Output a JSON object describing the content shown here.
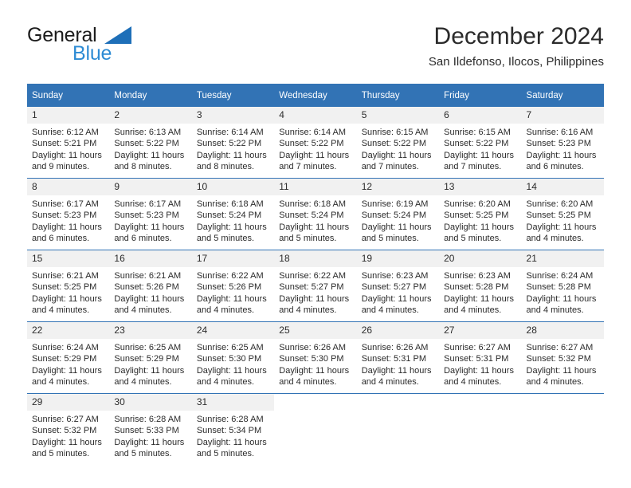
{
  "logo": {
    "word_one": "General",
    "word_two": "Blue",
    "triangle_color": "#1e6fb8",
    "blue_color": "#2d8bd4"
  },
  "header": {
    "title": "December 2024",
    "subtitle": "San Ildefonso, Ilocos, Philippines",
    "accent_color": "#3273b5"
  },
  "calendar": {
    "weekday_headers": [
      "Sunday",
      "Monday",
      "Tuesday",
      "Wednesday",
      "Thursday",
      "Friday",
      "Saturday"
    ],
    "weeks": [
      [
        {
          "day": "1",
          "sunrise": "Sunrise: 6:12 AM",
          "sunset": "Sunset: 5:21 PM",
          "daylight": "Daylight: 11 hours and 9 minutes."
        },
        {
          "day": "2",
          "sunrise": "Sunrise: 6:13 AM",
          "sunset": "Sunset: 5:22 PM",
          "daylight": "Daylight: 11 hours and 8 minutes."
        },
        {
          "day": "3",
          "sunrise": "Sunrise: 6:14 AM",
          "sunset": "Sunset: 5:22 PM",
          "daylight": "Daylight: 11 hours and 8 minutes."
        },
        {
          "day": "4",
          "sunrise": "Sunrise: 6:14 AM",
          "sunset": "Sunset: 5:22 PM",
          "daylight": "Daylight: 11 hours and 7 minutes."
        },
        {
          "day": "5",
          "sunrise": "Sunrise: 6:15 AM",
          "sunset": "Sunset: 5:22 PM",
          "daylight": "Daylight: 11 hours and 7 minutes."
        },
        {
          "day": "6",
          "sunrise": "Sunrise: 6:15 AM",
          "sunset": "Sunset: 5:22 PM",
          "daylight": "Daylight: 11 hours and 7 minutes."
        },
        {
          "day": "7",
          "sunrise": "Sunrise: 6:16 AM",
          "sunset": "Sunset: 5:23 PM",
          "daylight": "Daylight: 11 hours and 6 minutes."
        }
      ],
      [
        {
          "day": "8",
          "sunrise": "Sunrise: 6:17 AM",
          "sunset": "Sunset: 5:23 PM",
          "daylight": "Daylight: 11 hours and 6 minutes."
        },
        {
          "day": "9",
          "sunrise": "Sunrise: 6:17 AM",
          "sunset": "Sunset: 5:23 PM",
          "daylight": "Daylight: 11 hours and 6 minutes."
        },
        {
          "day": "10",
          "sunrise": "Sunrise: 6:18 AM",
          "sunset": "Sunset: 5:24 PM",
          "daylight": "Daylight: 11 hours and 5 minutes."
        },
        {
          "day": "11",
          "sunrise": "Sunrise: 6:18 AM",
          "sunset": "Sunset: 5:24 PM",
          "daylight": "Daylight: 11 hours and 5 minutes."
        },
        {
          "day": "12",
          "sunrise": "Sunrise: 6:19 AM",
          "sunset": "Sunset: 5:24 PM",
          "daylight": "Daylight: 11 hours and 5 minutes."
        },
        {
          "day": "13",
          "sunrise": "Sunrise: 6:20 AM",
          "sunset": "Sunset: 5:25 PM",
          "daylight": "Daylight: 11 hours and 5 minutes."
        },
        {
          "day": "14",
          "sunrise": "Sunrise: 6:20 AM",
          "sunset": "Sunset: 5:25 PM",
          "daylight": "Daylight: 11 hours and 4 minutes."
        }
      ],
      [
        {
          "day": "15",
          "sunrise": "Sunrise: 6:21 AM",
          "sunset": "Sunset: 5:25 PM",
          "daylight": "Daylight: 11 hours and 4 minutes."
        },
        {
          "day": "16",
          "sunrise": "Sunrise: 6:21 AM",
          "sunset": "Sunset: 5:26 PM",
          "daylight": "Daylight: 11 hours and 4 minutes."
        },
        {
          "day": "17",
          "sunrise": "Sunrise: 6:22 AM",
          "sunset": "Sunset: 5:26 PM",
          "daylight": "Daylight: 11 hours and 4 minutes."
        },
        {
          "day": "18",
          "sunrise": "Sunrise: 6:22 AM",
          "sunset": "Sunset: 5:27 PM",
          "daylight": "Daylight: 11 hours and 4 minutes."
        },
        {
          "day": "19",
          "sunrise": "Sunrise: 6:23 AM",
          "sunset": "Sunset: 5:27 PM",
          "daylight": "Daylight: 11 hours and 4 minutes."
        },
        {
          "day": "20",
          "sunrise": "Sunrise: 6:23 AM",
          "sunset": "Sunset: 5:28 PM",
          "daylight": "Daylight: 11 hours and 4 minutes."
        },
        {
          "day": "21",
          "sunrise": "Sunrise: 6:24 AM",
          "sunset": "Sunset: 5:28 PM",
          "daylight": "Daylight: 11 hours and 4 minutes."
        }
      ],
      [
        {
          "day": "22",
          "sunrise": "Sunrise: 6:24 AM",
          "sunset": "Sunset: 5:29 PM",
          "daylight": "Daylight: 11 hours and 4 minutes."
        },
        {
          "day": "23",
          "sunrise": "Sunrise: 6:25 AM",
          "sunset": "Sunset: 5:29 PM",
          "daylight": "Daylight: 11 hours and 4 minutes."
        },
        {
          "day": "24",
          "sunrise": "Sunrise: 6:25 AM",
          "sunset": "Sunset: 5:30 PM",
          "daylight": "Daylight: 11 hours and 4 minutes."
        },
        {
          "day": "25",
          "sunrise": "Sunrise: 6:26 AM",
          "sunset": "Sunset: 5:30 PM",
          "daylight": "Daylight: 11 hours and 4 minutes."
        },
        {
          "day": "26",
          "sunrise": "Sunrise: 6:26 AM",
          "sunset": "Sunset: 5:31 PM",
          "daylight": "Daylight: 11 hours and 4 minutes."
        },
        {
          "day": "27",
          "sunrise": "Sunrise: 6:27 AM",
          "sunset": "Sunset: 5:31 PM",
          "daylight": "Daylight: 11 hours and 4 minutes."
        },
        {
          "day": "28",
          "sunrise": "Sunrise: 6:27 AM",
          "sunset": "Sunset: 5:32 PM",
          "daylight": "Daylight: 11 hours and 4 minutes."
        }
      ],
      [
        {
          "day": "29",
          "sunrise": "Sunrise: 6:27 AM",
          "sunset": "Sunset: 5:32 PM",
          "daylight": "Daylight: 11 hours and 5 minutes."
        },
        {
          "day": "30",
          "sunrise": "Sunrise: 6:28 AM",
          "sunset": "Sunset: 5:33 PM",
          "daylight": "Daylight: 11 hours and 5 minutes."
        },
        {
          "day": "31",
          "sunrise": "Sunrise: 6:28 AM",
          "sunset": "Sunset: 5:34 PM",
          "daylight": "Daylight: 11 hours and 5 minutes."
        },
        {
          "day": "",
          "sunrise": "",
          "sunset": "",
          "daylight": ""
        },
        {
          "day": "",
          "sunrise": "",
          "sunset": "",
          "daylight": ""
        },
        {
          "day": "",
          "sunrise": "",
          "sunset": "",
          "daylight": ""
        },
        {
          "day": "",
          "sunrise": "",
          "sunset": "",
          "daylight": ""
        }
      ]
    ]
  }
}
